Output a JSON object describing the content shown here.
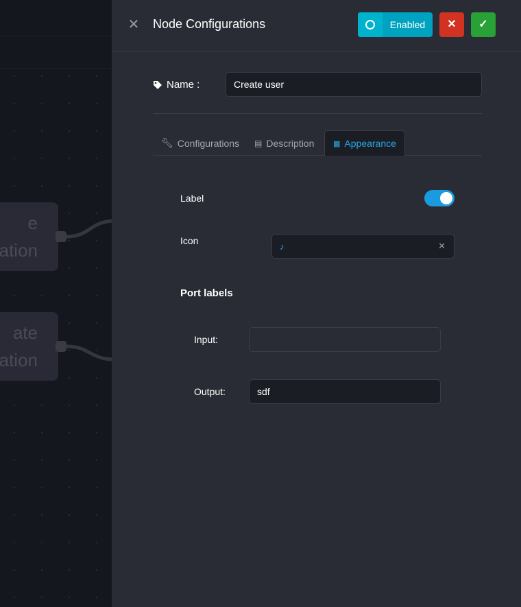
{
  "canvas": {
    "nodes": [
      {
        "line1": "e",
        "line2": "ation"
      },
      {
        "line1": "ate",
        "line2": "ation"
      }
    ]
  },
  "header": {
    "title": "Node Configurations",
    "enabled_label": "Enabled",
    "cancel_icon": "✕",
    "confirm_icon": "✓"
  },
  "name": {
    "label": "Name :",
    "value": "Create user"
  },
  "tabs": [
    {
      "label": "Configurations",
      "icon": "wrench-icon"
    },
    {
      "label": "Description",
      "icon": "document-icon"
    },
    {
      "label": "Appearance",
      "icon": "appearance-icon",
      "active": true
    }
  ],
  "appearance": {
    "label_label": "Label",
    "label_enabled": true,
    "icon_label": "Icon",
    "icon_value": "route-icon",
    "port_labels_title": "Port labels",
    "input_label": "Input:",
    "input_value": "",
    "output_label": "Output:",
    "output_value": "sdf"
  },
  "colors": {
    "accent": "#2aa8e8",
    "enabled": "#00a3bf",
    "danger": "#d23222",
    "success": "#28a236"
  }
}
